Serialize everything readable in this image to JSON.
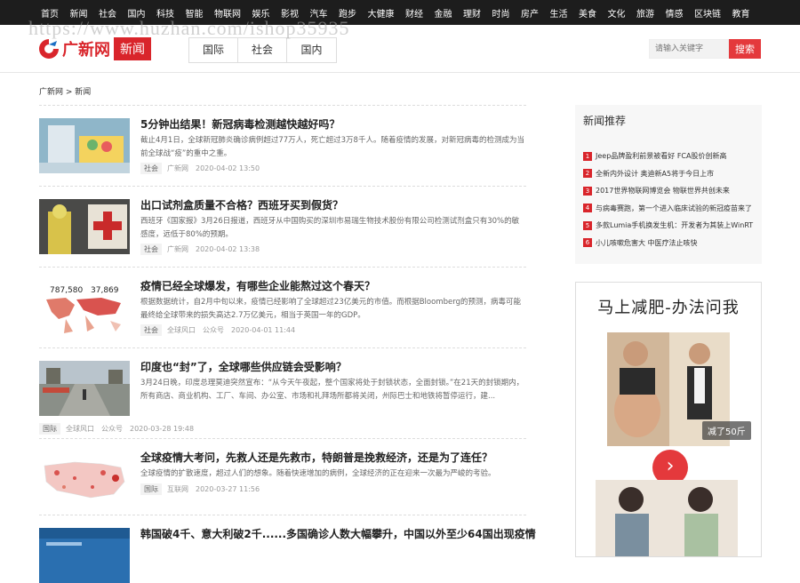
{
  "watermark": "https://www.huzhan.com/ishop35935",
  "topnav": [
    "首页",
    "新闻",
    "社会",
    "国内",
    "科技",
    "智能",
    "物联网",
    "娱乐",
    "影视",
    "汽车",
    "跑步",
    "大健康",
    "财经",
    "金融",
    "理财",
    "时尚",
    "房产",
    "生活",
    "美食",
    "文化",
    "旅游",
    "情感",
    "区块链",
    "教育"
  ],
  "header": {
    "logo_text": "广新网",
    "logo_box": "新闻",
    "subtabs": [
      "国际",
      "社会",
      "国内"
    ],
    "search_placeholder": "请输入关键字",
    "search_button": "搜索"
  },
  "breadcrumb": "广新网 > 新闻",
  "news": [
    {
      "title": "5分钟出结果！新冠病毒检测越快越好吗？",
      "summary": "截止4月1日，全球新冠肺炎确诊病例超过77万人，死亡超过3万8千人。随着疫情的发展，对新冠病毒的检测成为当前全球战“疫”的重中之重。",
      "tag": "社会",
      "source": "广新网",
      "source2": "",
      "time": "2020-04-02 13:50"
    },
    {
      "title": "出口试剂盒质量不合格？西班牙买到假货？",
      "summary": "西班牙《国家报》3月26日报道，西班牙从中国购买的深圳市易瑞生物技术股份有限公司检测试剂盒只有30%的敏感度，远低于80%的预期。",
      "tag": "社会",
      "source": "广新网",
      "source2": "",
      "time": "2020-04-02 13:38"
    },
    {
      "title": "疫情已经全球爆发，有哪些企业能熬过这个春天？",
      "summary": "根据数据统计，自2月中旬以来，疫情已经影响了全球超过23亿美元的市值。而根据Bloomberg的预测，病毒可能最终给全球带来的损失高达2.7万亿美元，相当于英国一年的GDP。",
      "tag": "社会",
      "source": "全球风口",
      "source2": "公众号",
      "time": "2020-04-01 11:44"
    },
    {
      "title": "印度也“封”了，全球哪些供应链会受影响？",
      "summary": "3月24日晚，印度总理莫迪突然宣布：“从今天午夜起，整个国家将处于封锁状态，全面封锁。”在21天的封锁期内，所有商店、商业机构、工厂、车间、办公室、市场和礼拜场所都将关闭，州际巴士和地铁将暂停运行，建...",
      "tag": "国际",
      "source": "全球风口",
      "source2": "公众号",
      "time": "2020-03-28 19:48"
    },
    {
      "title": "全球疫情大考问，先救人还是先救市，特朗普是挽救经济，还是为了连任？",
      "summary": "全球疫情的扩散速度，超过人们的想象。随着快速增加的病例，全球经济的正在迎来一次最为严峻的考验。",
      "tag": "国际",
      "source": "互联网",
      "source2": "",
      "time": "2020-03-27 11:56"
    },
    {
      "title": "韩国破4千、意大利破2千......多国确诊人数大幅攀升，中国以外至少64国出现疫情",
      "summary": "",
      "tag": "",
      "source": "",
      "source2": "",
      "time": ""
    }
  ],
  "thumb3_numbers": [
    "787,580",
    "37,869"
  ],
  "sidebar": {
    "title": "新闻推荐",
    "items": [
      "Jeep品牌盈利前景被看好 FCA股价创新高",
      "全新内外设计 奥迪新A5将于今日上市",
      "2017世界物联网博览会 物联世界共创未来",
      "与病毒赛跑，第一个进入临床试验的新冠疫苗来了",
      "多款Lumia手机换发生机：开发者为其装上WinRT",
      "小儿咳嗽危害大 中医疗法止咳快"
    ],
    "ad_title": "马上减肥-办法问我",
    "ad_badge": "减了50斤",
    "ad_button": "›"
  }
}
